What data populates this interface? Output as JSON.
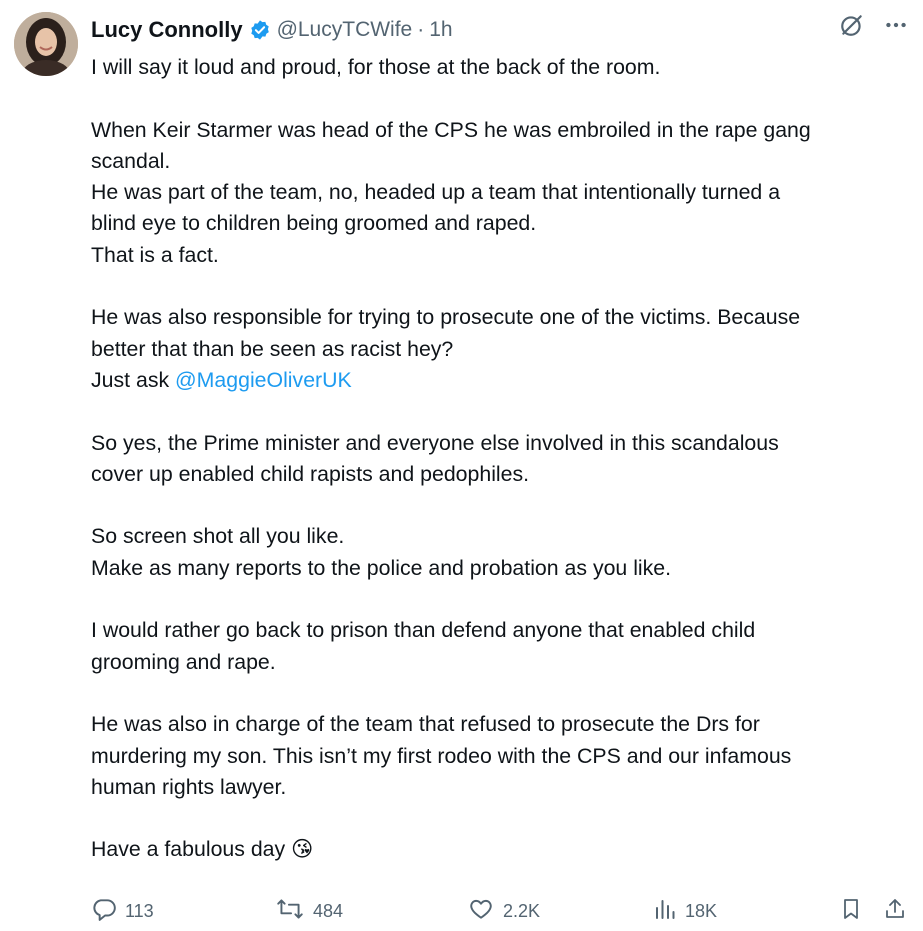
{
  "author": {
    "name": "Lucy Connolly",
    "handle": "@LucyTCWife",
    "separator": "·",
    "time": "1h"
  },
  "tweet": {
    "lines": [
      "I will say it loud and proud, for those at the back of the room.",
      "",
      "When Keir Starmer was head of the CPS he was embroiled in the rape gang",
      "scandal.",
      "He was part of the team, no, headed up a team that intentionally turned a",
      "blind eye to children being groomed and raped.",
      "That is a fact.",
      "",
      "He was also responsible for trying to prosecute one of the victims. Because",
      "better that than be seen as racist hey?",
      "",
      "",
      "So yes, the Prime minister and everyone else involved in this scandalous",
      "cover up enabled child rapists and pedophiles.",
      "",
      "So screen shot all you like.",
      "Make as many reports to the police and probation as you like.",
      "",
      "I would rather go back to prison than defend anyone that enabled child",
      "grooming and rape.",
      "",
      "He was also in charge of the team that refused to prosecute the Drs for",
      "murdering my son. This isn’t my first rodeo with the CPS and our infamous",
      "human rights lawyer.",
      "",
      "Have a fabulous day"
    ],
    "just_ask_prefix": "Just ask ",
    "mention": "@MaggieOliverUK",
    "emoji": "😘"
  },
  "actions": {
    "replies": "113",
    "reposts": "484",
    "likes": "2.2K",
    "views": "18K"
  },
  "colors": {
    "accent": "#1d9bf0",
    "secondary_text": "#536471",
    "primary_text": "#0f1419"
  },
  "icons": [
    "verified-badge-icon",
    "grok-icon",
    "more-icon",
    "reply-icon",
    "repost-icon",
    "like-icon",
    "views-icon",
    "bookmark-icon",
    "share-icon"
  ]
}
